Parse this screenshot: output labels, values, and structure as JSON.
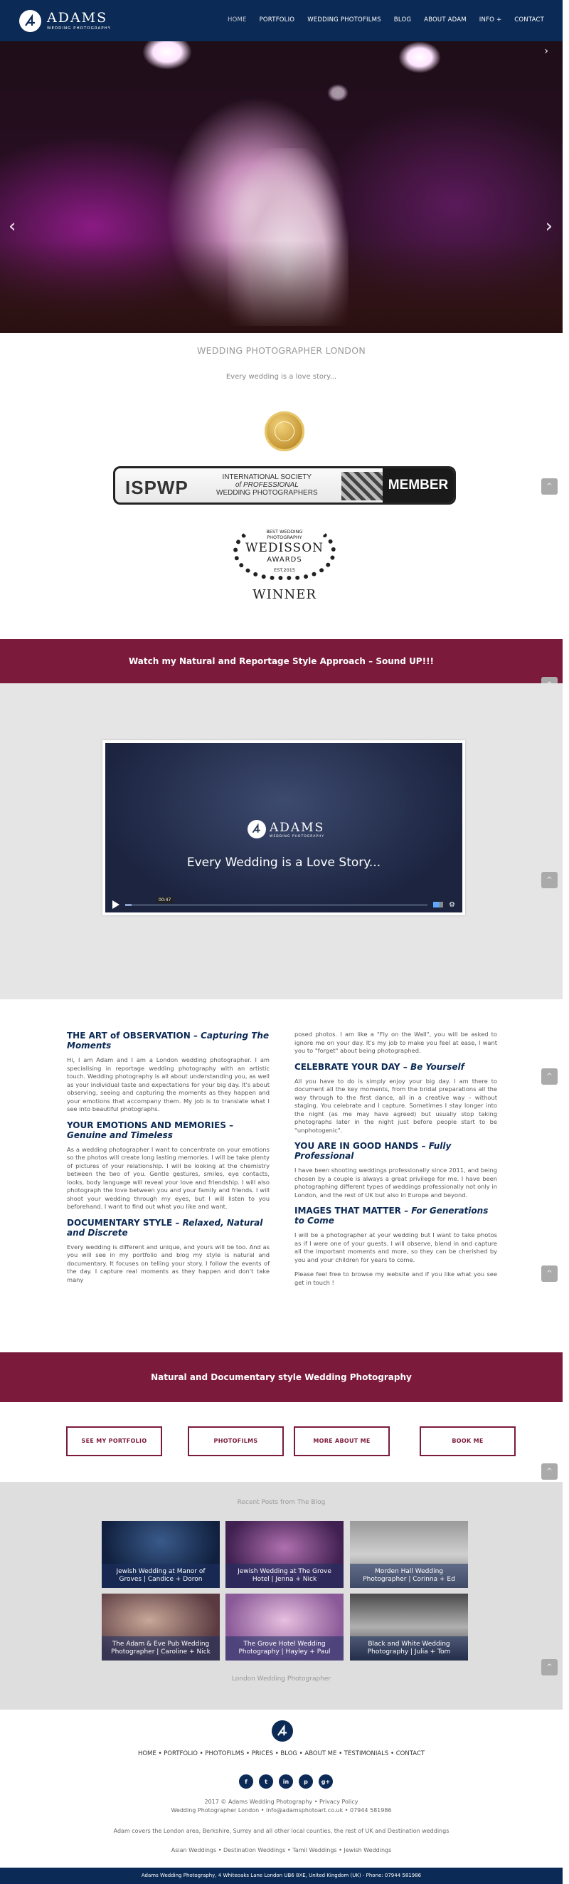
{
  "header": {
    "brand_name": "ADAMS",
    "brand_tagline": "WEDDING PHOTOGRAPHY",
    "nav": [
      "HOME",
      "PORTFOLIO",
      "WEDDING PHOTOFILMS",
      "BLOG",
      "ABOUT ADAM",
      "INFO +",
      "CONTACT"
    ],
    "active_nav": "HOME"
  },
  "hero": {
    "prev_icon": "chevron-left-icon",
    "next_icon": "chevron-right-icon"
  },
  "intro": {
    "title": "WEDDING PHOTOGRAPHER LONDON",
    "tagline": "Every wedding is a love story..."
  },
  "badges": {
    "ispwp_logo": "ISPWP",
    "ispwp_line1": "INTERNATIONAL SOCIETY",
    "ispwp_line2": "of PROFESSIONAL",
    "ispwp_line3": "WEDDING PHOTOGRAPHERS",
    "ispwp_member": "MEMBER",
    "wedisson_l1a": "BEST WEDDING",
    "wedisson_l1b": "PHOTOGRAPHY",
    "wedisson_name": "WEDISSON",
    "wedisson_awards": "AWARDS",
    "wedisson_est": "EST.2015",
    "wedisson_winner": "WINNER"
  },
  "banner1": "Watch my Natural and Reportage Style Approach – Sound UP!!!",
  "video": {
    "brand_name": "ADAMS",
    "brand_tagline": "WEDDING PHOTOGRAPHY",
    "title": "Every Wedding is a Love Story...",
    "time": "00:47",
    "progress": 0.02
  },
  "text_left": {
    "h1": "THE ART of OBSERVATION –",
    "h1i": "Capturing The Moments",
    "p1": "Hi, I am Adam and I am a London wedding photographer. I am specialising in reportage wedding photography with an artistic touch. Wedding photography is all about understanding you, as well as your individual taste and expectations for your big day. It's about observing, seeing and capturing the moments as they happen and your emotions that accompany them. My job is to translate what I see into beautiful photographs.",
    "h2": "YOUR EMOTIONS AND MEMORIES –",
    "h2i": "Genuine and Timeless",
    "p2": "As a wedding photographer I want to concentrate on your emotions so the photos will create long lasting memories. I will be take plenty of pictures of your relationship. I will be looking at the chemistry between the two of you. Gentle gestures, smiles, eye contacts, looks, body language will reveal your love and friendship. I will also photograph the love between you and your family and friends. I will shoot your wedding through my eyes, but I will listen to you beforehand. I want to find out what you like and want.",
    "h3": "DOCUMENTARY STYLE –",
    "h3i": "Relaxed, Natural and Discrete",
    "p3": "Every wedding is different and unique, and yours will be too. And as you will see in my portfolio and blog my style is natural and documentary. It focuses on telling your story. I follow the events of the day. I capture real moments as they happen and don't take many"
  },
  "text_right": {
    "p0": "posed photos. I am like a \"Fly on the Wall\", you will be asked to ignore me on your day. It's my job to make you feel at ease, I want you to \"forget\" about being photographed.",
    "h1": "CELEBRATE YOUR DAY –",
    "h1i": "Be Yourself",
    "p1": "All you have to do is simply enjoy your big day. I am there to document all the key moments, from the bridal preparations all the way through to the first dance, all in a creative way – without staging. You celebrate and I capture. Sometimes I stay longer into the night (as me may have agreed) but usually stop taking photographs later in the night just before people start to be \"unphotogenic\".",
    "h2": "YOU ARE IN GOOD HANDS –",
    "h2i": "Fully Professional",
    "p2": "I have been shooting weddings professionally since 2011, and being chosen by a couple is always a great privilege for me. I have been photographing different types of weddings professionally not only in London, and the rest of UK but also in Europe and beyond.",
    "h3": "IMAGES THAT MATTER –",
    "h3i": "For Generations to Come",
    "p3": "I will be a photographer at your wedding but I want to take photos as if I were one of your guests. I will observe, blend in and capture all the important moments and more, so they can be cherished by you and your children for years to come.",
    "p4": "Please feel free to browse my website and if you like what you see get in touch !"
  },
  "banner2": "Natural and Documentary style Wedding Photography",
  "buttons": [
    "SEE MY PORTFOLIO",
    "PHOTOFILMS",
    "MORE ABOUT ME",
    "BOOK ME"
  ],
  "blog": {
    "heading": "Recent Posts from The Blog",
    "posts": [
      "Jewish Wedding at Manor of Groves | Candice + Doron",
      "Jewish Wedding at The Grove Hotel | Jenna + Nick",
      "Morden Hall Wedding Photographer | Corinna + Ed",
      "The Adam & Eve Pub Wedding Photographer | Caroline + Nick",
      "The Grove Hotel Wedding Photography | Hayley + Paul",
      "Black and White Wedding Photography | Julia + Tom"
    ],
    "footer": "London Wedding Photographer"
  },
  "footer": {
    "nav": "HOME • PORTFOLIO • PHOTOFILMS • PRICES • BLOG • ABOUT ME • TESTIMONIALS • CONTACT",
    "social": [
      "f",
      "t",
      "in",
      "p",
      "g+"
    ],
    "copyright": "2017 © Adams Wedding Photography • Privacy Policy",
    "contact": "Wedding Photographer London • info@adamsphotoart.co.uk • 07944 581986",
    "areas": "Adam covers the London area, Berkshire, Surrey and all other local counties, the rest of UK and Destination weddings",
    "links": "Asian Weddings • Destination Weddings • Tamil Weddings • Jewish Weddings",
    "bottom": "Adams Wedding Photography, 4 Whiteoaks Lane London UB6 8XE, United Kingdom (UK) - Phone: 07944 581986"
  },
  "colors": {
    "navy": "#0b2a55",
    "burgundy": "#7b1a3a"
  }
}
